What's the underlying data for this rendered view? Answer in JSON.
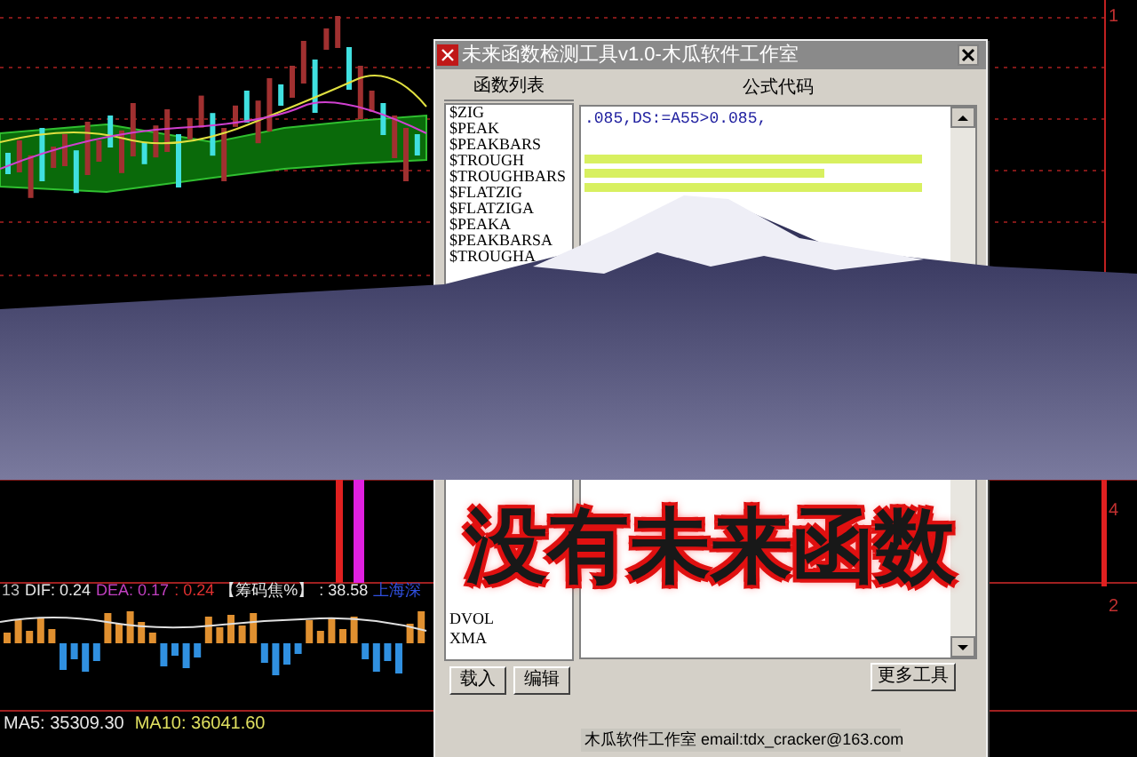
{
  "chart": {
    "axis_labels": [
      "1",
      "4",
      "2"
    ],
    "macd_legend": [
      {
        "text": "13",
        "color": "#c0c0c0"
      },
      {
        "text": "DIF: 0.24",
        "color": "#e8e8e8"
      },
      {
        "text": "DEA: 0.17",
        "color": "#c040c0"
      },
      {
        "text": ": 0.24",
        "color": "#e03030"
      },
      {
        "text": "【筹码焦%】",
        "color": "#e8e8e8"
      },
      {
        "text": ": 38.58",
        "color": "#e8e8e8"
      },
      {
        "text": "上海深",
        "color": "#3050e0"
      }
    ],
    "volume_legend": [
      {
        "text": "MA5: 35309.30",
        "color": "#e8e8e8"
      },
      {
        "text": "MA10: 36041.60",
        "color": "#e0e060"
      }
    ]
  },
  "dialog": {
    "title": "未来函数检测工具v1.0-木瓜软件工作室",
    "list_header": "函数列表",
    "list_items": [
      "$ZIG",
      "$PEAK",
      "$PEAKBARS",
      "$TROUGH",
      "$TROUGHBARS",
      "$FLATZIG",
      "$FLATZIGA",
      "$PEAKA",
      "$PEAKBARSA",
      "$TROUGHA"
    ],
    "list_items_lower": [
      "DVOL",
      "XMA"
    ],
    "code_header": "公式代码",
    "code_line": ".085,DS:=A55>0.085,",
    "buttons": [
      "载入",
      "编辑"
    ],
    "more_button": "更多工具",
    "footer": "木瓜软件工作室 email:tdx_cracker@163.com"
  },
  "overlay_caption": "没有未来函数"
}
